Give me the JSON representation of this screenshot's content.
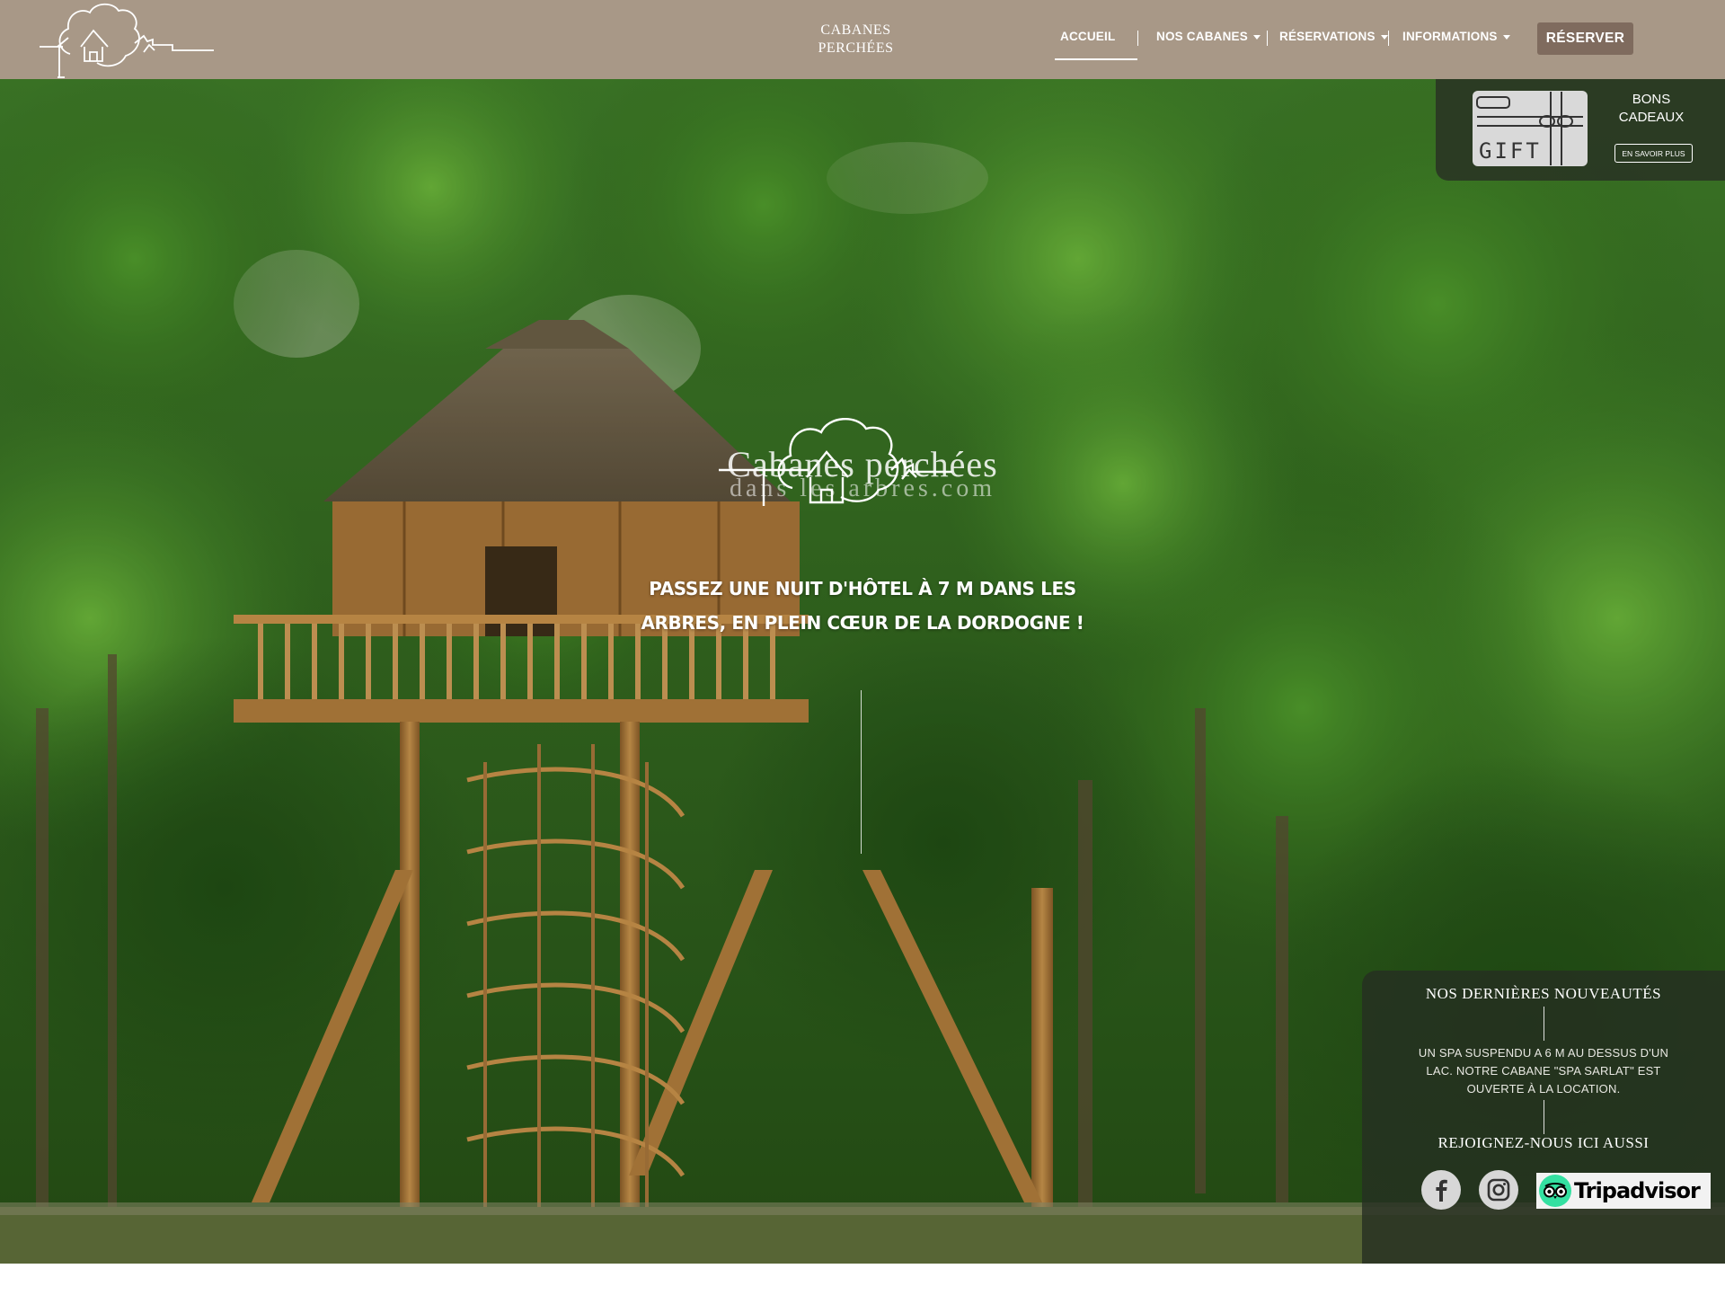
{
  "header": {
    "brand_line1": "CABANES",
    "brand_line2": "PERCHÉES",
    "nav": [
      {
        "label": "ACCUEIL",
        "has_dropdown": false,
        "active": true
      },
      {
        "label": "NOS CABANES",
        "has_dropdown": true
      },
      {
        "label": "RÉSERVATIONS",
        "has_dropdown": true
      },
      {
        "label": "INFORMATIONS",
        "has_dropdown": true
      }
    ],
    "reserve_label": "RÉSERVER",
    "colors": {
      "bar": "#a89887",
      "button": "#7f6b5e"
    }
  },
  "gift": {
    "card_text": "GIFT",
    "title_line1": "BONS",
    "title_line2": "CADEAUX",
    "more_label": "EN SAVOIR PLUS"
  },
  "hero": {
    "logo_title": "Cabanes perchées",
    "logo_subtitle": "dans les arbres.com",
    "tagline_line1": "PASSEZ UNE NUIT D'HÔTEL À 7 M DANS LES",
    "tagline_line2": "ARBRES, EN PLEIN CŒUR DE LA DORDOGNE !"
  },
  "news": {
    "title": "NOS DERNIÈRES NOUVEAUTÉS",
    "text": "UN SPA SUSPENDU A 6 M AU DESSUS D'UN LAC. NOTRE CABANE \"SPA SARLAT\" EST OUVERTE À LA LOCATION.",
    "join_title": "REJOIGNEZ-NOUS ICI AUSSI",
    "social": [
      {
        "name": "facebook-icon"
      },
      {
        "name": "instagram-icon"
      }
    ],
    "tripadvisor_label": "Tripadvisor",
    "colors": {
      "tripadvisor_green": "#34e0a1"
    }
  }
}
